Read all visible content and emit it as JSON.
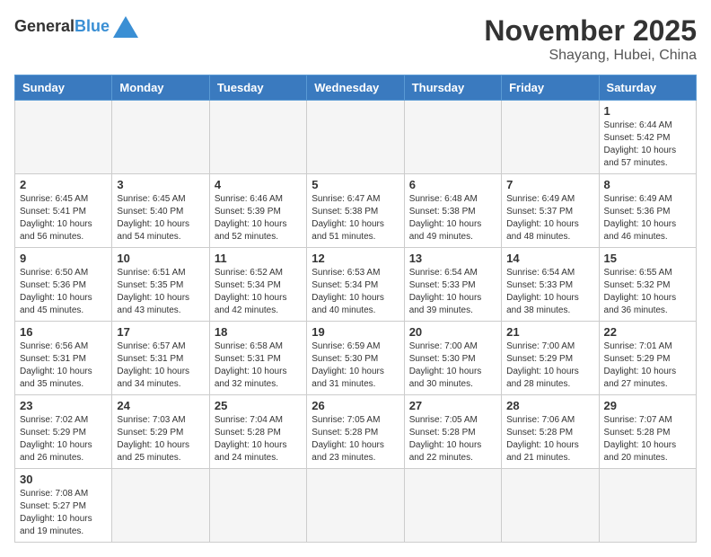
{
  "header": {
    "logo_general": "General",
    "logo_blue": "Blue",
    "month": "November 2025",
    "location": "Shayang, Hubei, China"
  },
  "days_of_week": [
    "Sunday",
    "Monday",
    "Tuesday",
    "Wednesday",
    "Thursday",
    "Friday",
    "Saturday"
  ],
  "weeks": [
    [
      {
        "day": "",
        "info": ""
      },
      {
        "day": "",
        "info": ""
      },
      {
        "day": "",
        "info": ""
      },
      {
        "day": "",
        "info": ""
      },
      {
        "day": "",
        "info": ""
      },
      {
        "day": "",
        "info": ""
      },
      {
        "day": "1",
        "info": "Sunrise: 6:44 AM\nSunset: 5:42 PM\nDaylight: 10 hours and 57 minutes."
      }
    ],
    [
      {
        "day": "2",
        "info": "Sunrise: 6:45 AM\nSunset: 5:41 PM\nDaylight: 10 hours and 56 minutes."
      },
      {
        "day": "3",
        "info": "Sunrise: 6:45 AM\nSunset: 5:40 PM\nDaylight: 10 hours and 54 minutes."
      },
      {
        "day": "4",
        "info": "Sunrise: 6:46 AM\nSunset: 5:39 PM\nDaylight: 10 hours and 52 minutes."
      },
      {
        "day": "5",
        "info": "Sunrise: 6:47 AM\nSunset: 5:38 PM\nDaylight: 10 hours and 51 minutes."
      },
      {
        "day": "6",
        "info": "Sunrise: 6:48 AM\nSunset: 5:38 PM\nDaylight: 10 hours and 49 minutes."
      },
      {
        "day": "7",
        "info": "Sunrise: 6:49 AM\nSunset: 5:37 PM\nDaylight: 10 hours and 48 minutes."
      },
      {
        "day": "8",
        "info": "Sunrise: 6:49 AM\nSunset: 5:36 PM\nDaylight: 10 hours and 46 minutes."
      }
    ],
    [
      {
        "day": "9",
        "info": "Sunrise: 6:50 AM\nSunset: 5:36 PM\nDaylight: 10 hours and 45 minutes."
      },
      {
        "day": "10",
        "info": "Sunrise: 6:51 AM\nSunset: 5:35 PM\nDaylight: 10 hours and 43 minutes."
      },
      {
        "day": "11",
        "info": "Sunrise: 6:52 AM\nSunset: 5:34 PM\nDaylight: 10 hours and 42 minutes."
      },
      {
        "day": "12",
        "info": "Sunrise: 6:53 AM\nSunset: 5:34 PM\nDaylight: 10 hours and 40 minutes."
      },
      {
        "day": "13",
        "info": "Sunrise: 6:54 AM\nSunset: 5:33 PM\nDaylight: 10 hours and 39 minutes."
      },
      {
        "day": "14",
        "info": "Sunrise: 6:54 AM\nSunset: 5:33 PM\nDaylight: 10 hours and 38 minutes."
      },
      {
        "day": "15",
        "info": "Sunrise: 6:55 AM\nSunset: 5:32 PM\nDaylight: 10 hours and 36 minutes."
      }
    ],
    [
      {
        "day": "16",
        "info": "Sunrise: 6:56 AM\nSunset: 5:31 PM\nDaylight: 10 hours and 35 minutes."
      },
      {
        "day": "17",
        "info": "Sunrise: 6:57 AM\nSunset: 5:31 PM\nDaylight: 10 hours and 34 minutes."
      },
      {
        "day": "18",
        "info": "Sunrise: 6:58 AM\nSunset: 5:31 PM\nDaylight: 10 hours and 32 minutes."
      },
      {
        "day": "19",
        "info": "Sunrise: 6:59 AM\nSunset: 5:30 PM\nDaylight: 10 hours and 31 minutes."
      },
      {
        "day": "20",
        "info": "Sunrise: 7:00 AM\nSunset: 5:30 PM\nDaylight: 10 hours and 30 minutes."
      },
      {
        "day": "21",
        "info": "Sunrise: 7:00 AM\nSunset: 5:29 PM\nDaylight: 10 hours and 28 minutes."
      },
      {
        "day": "22",
        "info": "Sunrise: 7:01 AM\nSunset: 5:29 PM\nDaylight: 10 hours and 27 minutes."
      }
    ],
    [
      {
        "day": "23",
        "info": "Sunrise: 7:02 AM\nSunset: 5:29 PM\nDaylight: 10 hours and 26 minutes."
      },
      {
        "day": "24",
        "info": "Sunrise: 7:03 AM\nSunset: 5:29 PM\nDaylight: 10 hours and 25 minutes."
      },
      {
        "day": "25",
        "info": "Sunrise: 7:04 AM\nSunset: 5:28 PM\nDaylight: 10 hours and 24 minutes."
      },
      {
        "day": "26",
        "info": "Sunrise: 7:05 AM\nSunset: 5:28 PM\nDaylight: 10 hours and 23 minutes."
      },
      {
        "day": "27",
        "info": "Sunrise: 7:05 AM\nSunset: 5:28 PM\nDaylight: 10 hours and 22 minutes."
      },
      {
        "day": "28",
        "info": "Sunrise: 7:06 AM\nSunset: 5:28 PM\nDaylight: 10 hours and 21 minutes."
      },
      {
        "day": "29",
        "info": "Sunrise: 7:07 AM\nSunset: 5:28 PM\nDaylight: 10 hours and 20 minutes."
      }
    ],
    [
      {
        "day": "30",
        "info": "Sunrise: 7:08 AM\nSunset: 5:27 PM\nDaylight: 10 hours and 19 minutes."
      },
      {
        "day": "",
        "info": ""
      },
      {
        "day": "",
        "info": ""
      },
      {
        "day": "",
        "info": ""
      },
      {
        "day": "",
        "info": ""
      },
      {
        "day": "",
        "info": ""
      },
      {
        "day": "",
        "info": ""
      }
    ]
  ]
}
